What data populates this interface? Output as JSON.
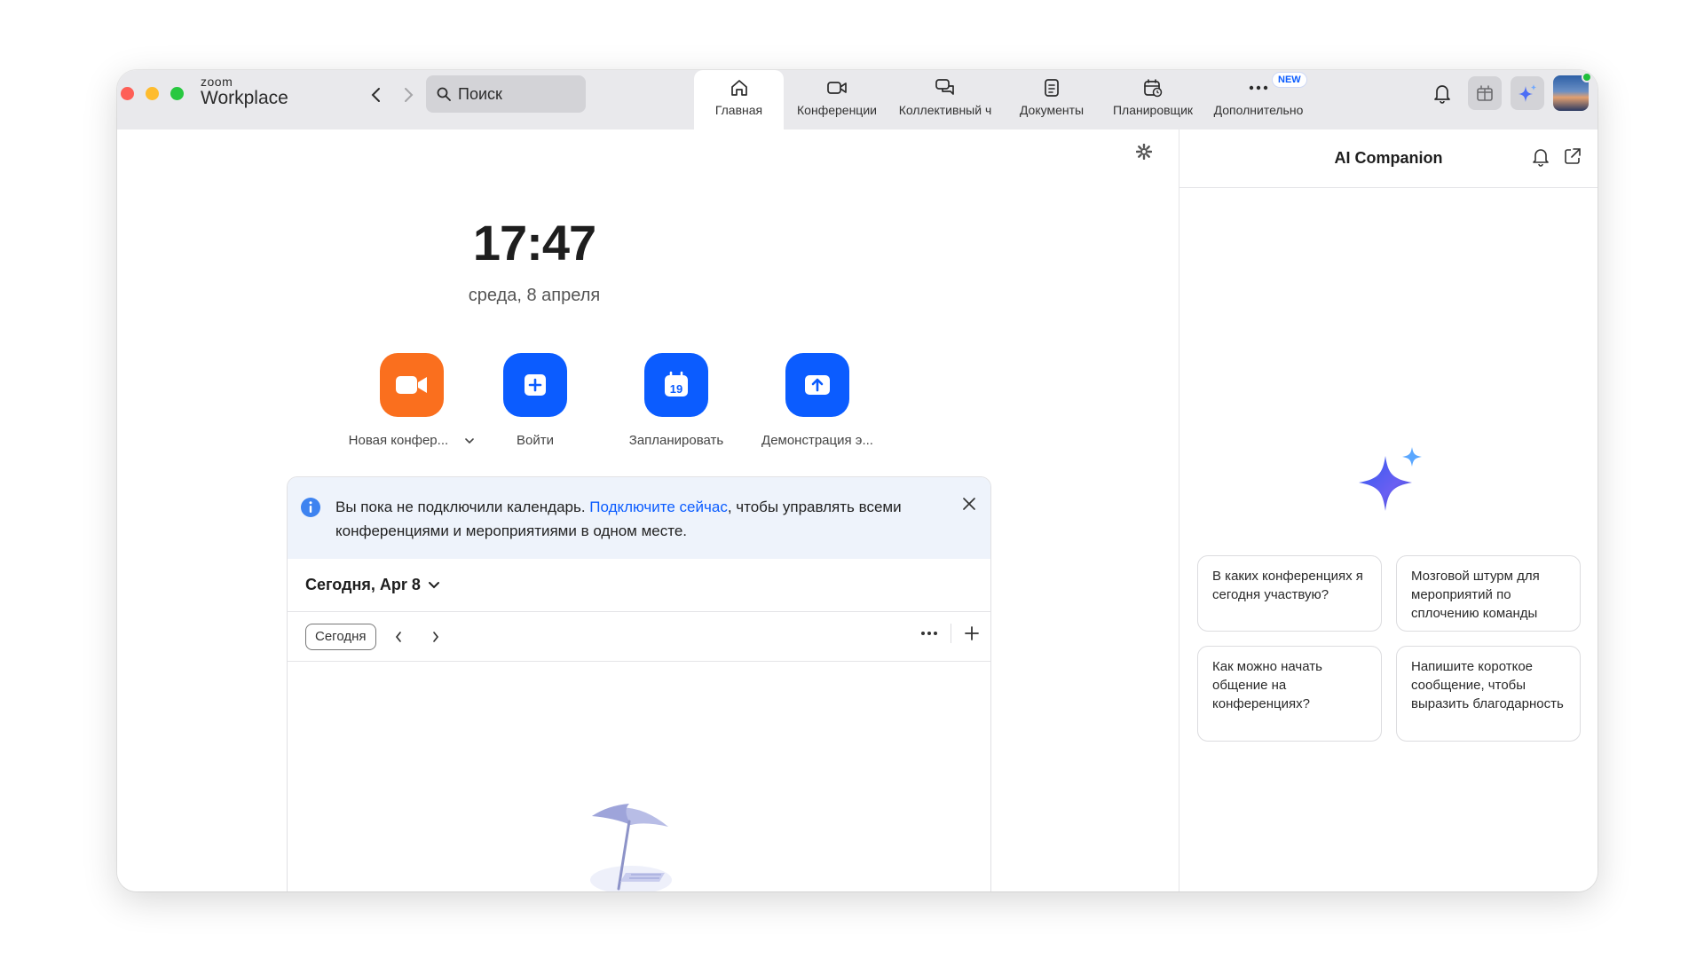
{
  "app": {
    "logo_top": "zoom",
    "logo_bottom": "Workplace"
  },
  "search": {
    "placeholder": "Поиск"
  },
  "tabs": [
    {
      "label": "Главная",
      "icon": "home-icon",
      "active": true
    },
    {
      "label": "Конференции",
      "icon": "video-camera-icon"
    },
    {
      "label": "Коллективный ч",
      "icon": "chat-bubbles-icon"
    },
    {
      "label": "Документы",
      "icon": "document-icon"
    },
    {
      "label": "Планировщик",
      "icon": "calendar-clock-icon"
    },
    {
      "label": "Дополнительно",
      "icon": "more-dots-icon",
      "badge": "NEW"
    }
  ],
  "main": {
    "time": "17:47",
    "date": "среда, 8 апреля",
    "actions": [
      {
        "label": "Новая конфер...",
        "icon": "video-camera-icon",
        "color": "#fa6f1e",
        "has_dropdown": true
      },
      {
        "label": "Войти",
        "icon": "plus-icon",
        "color": "#0b5cff"
      },
      {
        "label": "Запланировать",
        "icon": "calendar-icon",
        "color": "#0b5cff",
        "calendar_day": "19"
      },
      {
        "label": "Демонстрация э...",
        "icon": "share-screen-icon",
        "color": "#0b5cff"
      }
    ],
    "calendar": {
      "banner_before": "Вы пока не подключили календарь. ",
      "banner_link": "Подключите сейчас",
      "banner_after": ", чтобы управлять всеми конференциями и мероприятиями в одном месте.",
      "heading": "Сегодня, Apr 8",
      "today_button": "Сегодня"
    }
  },
  "companion": {
    "title": "AI Companion",
    "prompts": [
      "В каких конференциях я сегодня участвую?",
      "Мозговой штурм для мероприятий по сплочению команды",
      "Как можно начать общение на конференциях?",
      "Напишите короткое сообщение, чтобы выразить благодарность"
    ]
  },
  "colors": {
    "accent": "#0b5cff",
    "orange": "#fa6f1e",
    "titlebar": "#e9e9ec",
    "status_online": "#1fbf3b"
  }
}
